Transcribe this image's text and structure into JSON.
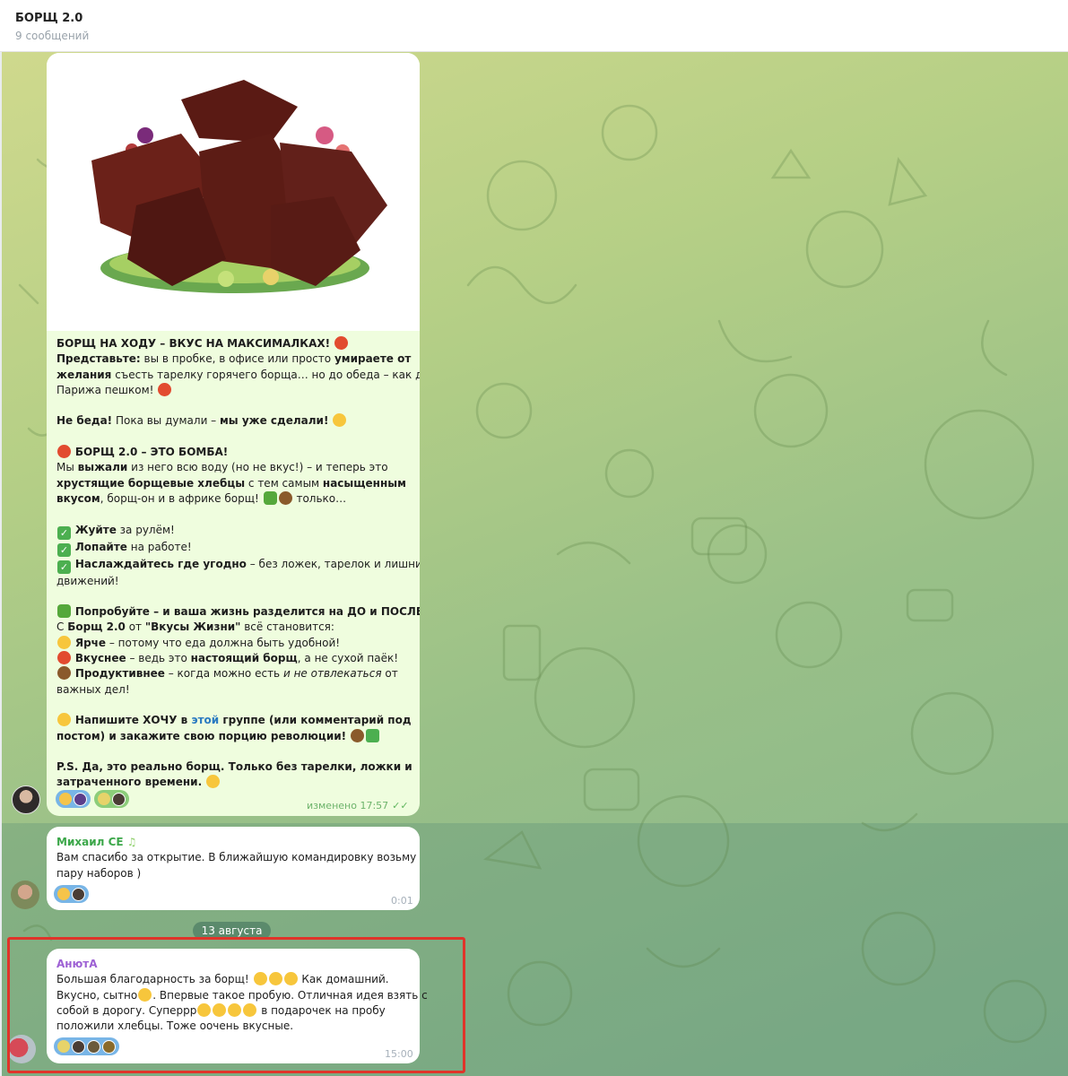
{
  "header": {
    "title": "БОРЩ 2.0",
    "subtitle": "9 сообщений"
  },
  "post": {
    "lines": [
      [
        "",
        "БОРЩ НА ХОДУ – ВКУС НА МАКСИМАЛКАХ! "
      ],
      [
        "Представьте:",
        " вы в пробке, в офисе или просто ",
        "умираете от"
      ],
      [
        "желания",
        " съесть тарелку горячего борща… но до обеда – как до"
      ],
      [
        "Парижа пешком! "
      ],
      [],
      [
        "Не беда!",
        " Пока вы думали – ",
        "мы уже сделали!"
      ],
      [],
      [
        "БОРЩ 2.0 – ЭТО БОМБА!"
      ],
      [
        "Мы ",
        "выжали",
        " из него всю воду (но не вкус!) – и теперь это"
      ],
      [
        "хрустящие борщевые хлебцы",
        " с тем самым ",
        "насыщенным"
      ],
      [
        "вкусом",
        ",  борщ-он и в африке борщ! ",
        " только…"
      ],
      [],
      [
        "Жуйте",
        " за рулём!"
      ],
      [
        "Лопайте",
        " на работе!"
      ],
      [
        "Наслаждайтесь где угодно",
        " – без ложек, тарелок и лишних"
      ],
      [
        "движений!"
      ],
      [],
      [
        "Попробуйте – и ваша жизнь разделится на ДО и ПОСЛЕ!"
      ],
      [
        "С ",
        "Борщ 2.0",
        " от ",
        "\"Вкусы Жизни\"",
        " всё становится:"
      ],
      [
        "Ярче",
        " – потому что еда должна быть удобной!"
      ],
      [
        "Вкуснее",
        " – ведь это ",
        "настоящий борщ",
        ", а не сухой паёк!"
      ],
      [
        "Продуктивнее",
        " – когда можно есть ",
        "и не отвлекаться",
        " от"
      ],
      [
        "важных дел!"
      ],
      [],
      [
        "Напишите ХОЧУ в ",
        "этой",
        " группе (или комментарий под"
      ],
      [
        "постом) и закажите свою порцию революции!"
      ],
      [],
      [
        "P.S. Да, это реально борщ. Только без тарелки, ложки и"
      ],
      [
        "затраченного времени."
      ]
    ],
    "t": {
      "l1": "БОРЩ НА ХОДУ – ВКУС НА МАКСИМАЛКАХ!",
      "l2a": "Представьте:",
      "l2b": " вы в пробке, в офисе или просто ",
      "l2c": "умираете от",
      "l3a": "желания",
      "l3b": " съесть тарелку горячего борща… но до обеда – как до",
      "l4": "Парижа пешком!",
      "l5a": "Не беда!",
      "l5b": " Пока вы думали – ",
      "l5c": "мы уже сделали!",
      "l6": "БОРЩ 2.0 – ЭТО БОМБА!",
      "l7a": "Мы ",
      "l7b": "выжали",
      "l7c": " из него всю воду (но не вкус!) – и теперь это",
      "l8a": "хрустящие борщевые хлебцы",
      "l8b": " с тем самым ",
      "l8c": "насыщенным",
      "l9a": "вкусом",
      "l9b": ",  борщ-он и в африке борщ!",
      "l9c": " только…",
      "l10a": "Жуйте",
      "l10b": " за рулём!",
      "l11a": "Лопайте",
      "l11b": " на работе!",
      "l12a": "Наслаждайтесь где угодно",
      "l12b": " – без ложек, тарелок и лишних",
      "l13": "движений!",
      "l14": "Попробуйте – и ваша жизнь разделится на ДО и ПОСЛЕ!",
      "l15a": "С ",
      "l15b": "Борщ 2.0",
      "l15c": " от ",
      "l15d": "\"Вкусы Жизни\"",
      "l15e": " всё становится:",
      "l16a": "Ярче",
      "l16b": " – потому что еда должна быть удобной!",
      "l17a": "Вкуснее",
      "l17b": " – ведь это ",
      "l17c": "настоящий борщ",
      "l17d": ", а не сухой паёк!",
      "l18a": "Продуктивнее",
      "l18b": " – когда можно есть ",
      "l18c": "и не отвлекаться",
      "l18d": " от",
      "l19": "важных дел!",
      "l20a": "Напишите ХОЧУ в ",
      "l20b": "этой",
      "l20c": " группе (или комментарий под",
      "l21": "постом) и закажите свою порцию революции!",
      "l22": "P.S. Да, это реально борщ. Только без тарелки, ложки и",
      "l23": "затраченного времени."
    },
    "meta": "изменено 17:57"
  },
  "message2": {
    "sender": "Михаил СЕ",
    "line1": "Вам спасибо за открытие. В ближайшую командировку возьму",
    "line2": "пару наборов )",
    "time": "0:01"
  },
  "date_separator": "13 августа",
  "message3": {
    "sender": "АнютА",
    "line1a": "Большая благодарность за борщ!",
    "line1b": " Как домашний.",
    "line2a": "Вкусно, сытно",
    "line2b": ". Впервые такое пробую. Отличная идея взять с",
    "line3a": "собой  в  дорогу. Суперрр",
    "line3b": " в подарочек на пробу",
    "line4": "положили хлебцы. Тоже оочень вкусные.",
    "time": "15:00"
  },
  "colors": {
    "post_bubble": "#effdde",
    "highlight": "#e0342a",
    "reaction_pill": "#78b5e6",
    "sender_green": "#3ca74a",
    "sender_purple": "#9d60d4"
  },
  "icons": [
    "rocket-emoji",
    "fire-emoji",
    "check-emoji",
    "lightbulb-emoji",
    "thumbs-up-emoji",
    "ok-hand-emoji",
    "clap-emoji",
    "read-ticks-icon"
  ]
}
